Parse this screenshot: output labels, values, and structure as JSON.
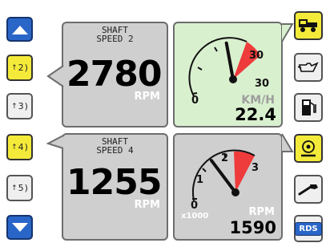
{
  "left_buttons": {
    "up": {
      "icon": "arrow-up-icon"
    },
    "b2": {
      "label": "2",
      "active": true
    },
    "b3": {
      "label": "3",
      "active": false
    },
    "b4": {
      "label": "4",
      "active": true
    },
    "b5": {
      "label": "5",
      "active": false
    },
    "down": {
      "icon": "arrow-down-icon"
    }
  },
  "panel_top_left": {
    "title_line1": "SHAFT",
    "title_line2": "SPEED 2",
    "value": "2780",
    "unit": "RPM"
  },
  "panel_bottom_left": {
    "title_line1": "SHAFT",
    "title_line2": "SPEED 4",
    "value": "1255",
    "unit": "RPM"
  },
  "speed_gauge": {
    "min_label": "0",
    "max_label": "30",
    "scale_label": "30",
    "unit": "KM/H",
    "value": "22.4",
    "needle_value": 22.4,
    "scale_max": 30
  },
  "rpm_gauge": {
    "ticks": [
      "0",
      "1",
      "2",
      "3"
    ],
    "multiplier": "x1000",
    "unit": "RPM",
    "value": "1590",
    "needle_value": 1.59,
    "scale_max": 3.3
  },
  "right_buttons": [
    {
      "icon": "truck-icon",
      "active": true
    },
    {
      "icon": "oil-can-icon",
      "active": false
    },
    {
      "icon": "fuel-pump-icon",
      "active": false
    },
    {
      "icon": "gauge-shaft-icon",
      "active": true
    },
    {
      "icon": "wrench-icon",
      "active": false
    },
    {
      "icon": "rds-icon",
      "label": "RDS",
      "active": false
    }
  ],
  "colors": {
    "yellow": "#f4ea3a",
    "blue": "#2a66c8",
    "gray_panel": "#cfcfcf",
    "green_panel": "#d9f0cf",
    "red_zone": "#ee3b3b"
  }
}
